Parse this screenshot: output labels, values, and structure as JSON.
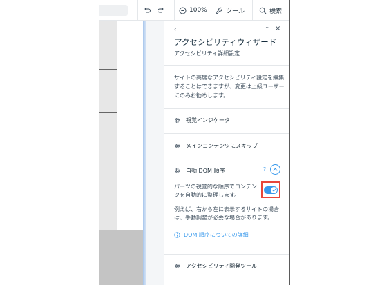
{
  "toolbar": {
    "zoom_label": "100%",
    "tools_label": "ツール",
    "search_label": "検索",
    "icons": [
      "undo-icon",
      "redo-icon",
      "zoom-out-icon",
      "wrench-icon",
      "search-icon"
    ]
  },
  "panel": {
    "title": "アクセシビリティウィザード",
    "subtitle": "アクセシビリティ詳細設定",
    "back_glyph": "‹",
    "more_glyph": "···",
    "close_glyph": "×",
    "description": "サイトの高度なアクセシビリティ設定を編集することはできますが、変更は上級ユーザーにのみお勧めします。",
    "sections": [
      {
        "label": "視覚インジケータ",
        "expanded": false
      },
      {
        "label": "メインコンテンツにスキップ",
        "expanded": false
      },
      {
        "label": "自動 DOM 順序",
        "expanded": true,
        "help": "?",
        "toggle_text": "パーツの視覚的な順序でコンテンツを自動的に整理します。",
        "toggle_on": true,
        "note": "例えば、右から左に表示するサイトの場合は、手動調整が必要な場合があります。",
        "link": "DOM 順序についての詳細"
      },
      {
        "label": "アクセシビリティ開発ツール",
        "expanded": false
      }
    ]
  },
  "colors": {
    "accent": "#3899ec",
    "highlight": "#e8463a",
    "text": "#20303c"
  }
}
